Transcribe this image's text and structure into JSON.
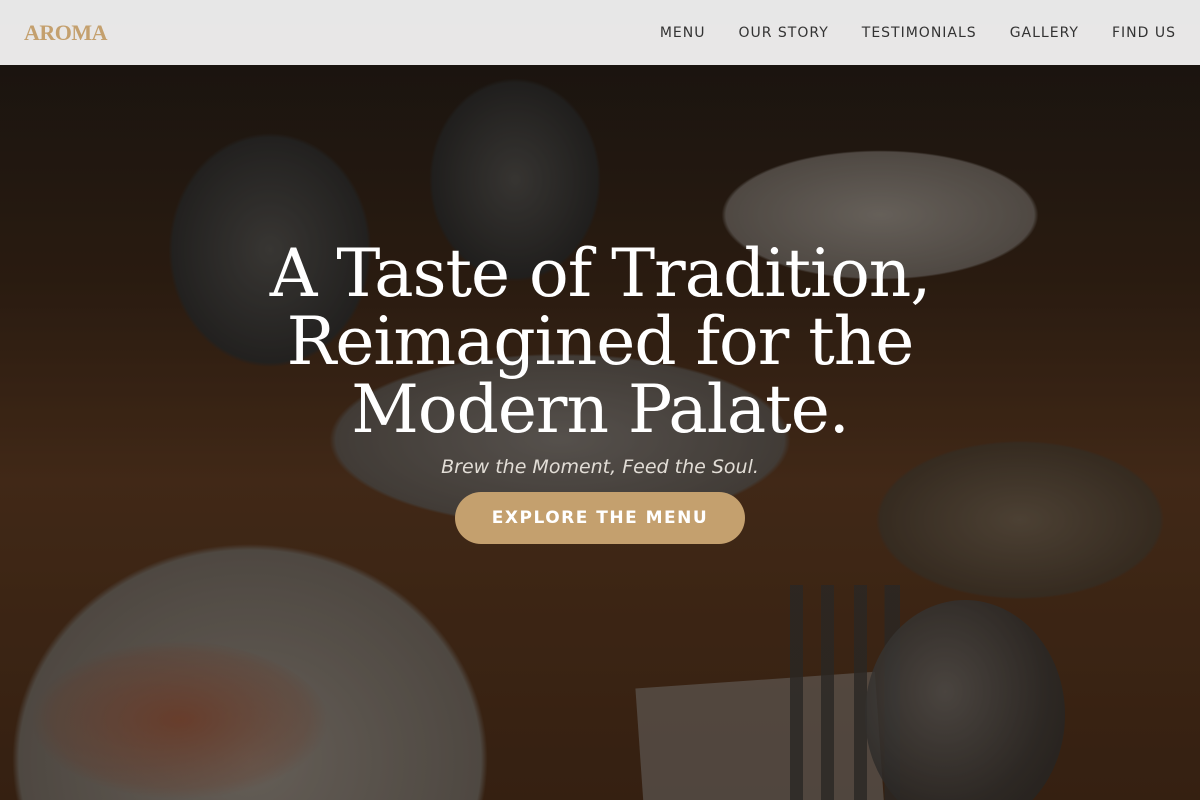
{
  "brand": {
    "logo": "AROMA"
  },
  "nav": {
    "items": [
      "MENU",
      "OUR STORY",
      "TESTIMONIALS",
      "GALLERY",
      "FIND US"
    ]
  },
  "hero": {
    "headline": "A Taste of Tradition, Reimagined for the Modern Palate.",
    "tagline": "Brew the Moment, Feed the Soul.",
    "cta_label": "EXPLORE THE MENU"
  },
  "colors": {
    "accent": "#c4a06e",
    "navbar_bg": "#f0f0f0",
    "nav_text": "#333333",
    "headline": "#ffffff"
  }
}
